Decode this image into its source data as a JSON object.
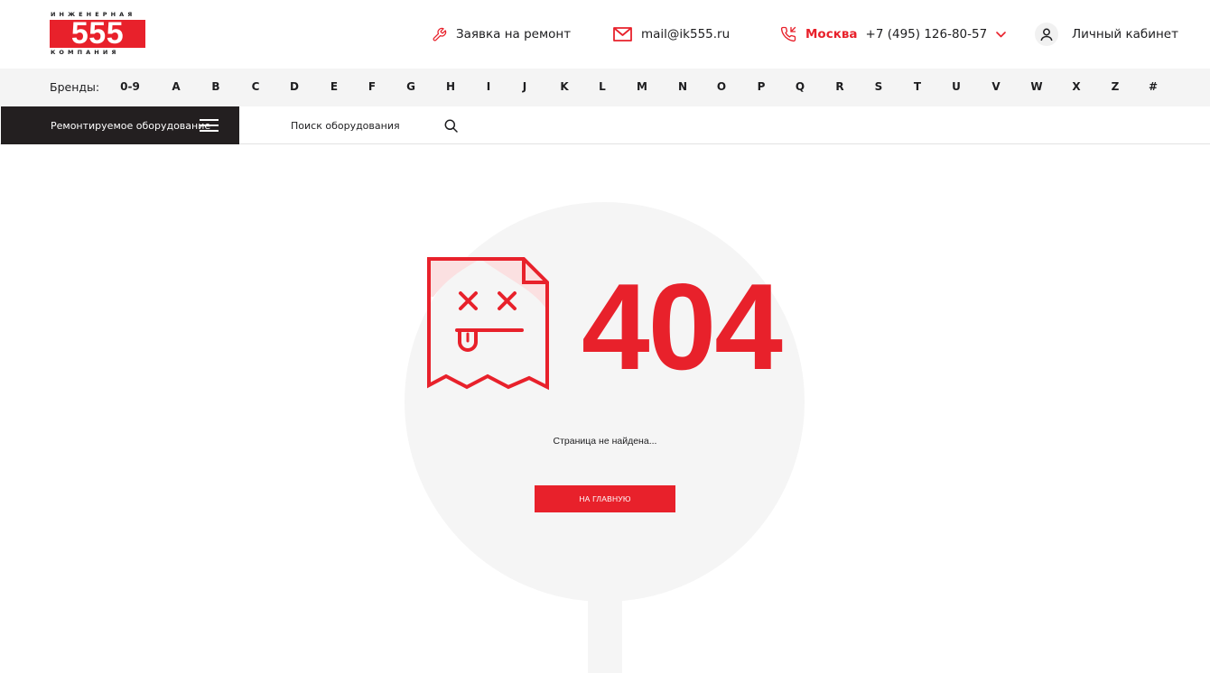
{
  "logo": {
    "top_caption": "ИНЖЕНЕРНАЯ",
    "number": "555",
    "bottom_caption": "КОМПАНИЯ"
  },
  "header": {
    "repair_request": "Заявка на ремонт",
    "repair_icon": "wrench-icon",
    "email": "mail@ik555.ru",
    "email_icon": "envelope-icon",
    "city": "Москва",
    "phone": "+7 (495) 126-80-57",
    "phone_icon": "phone-icon",
    "account": "Личный кабинет",
    "account_icon": "user-icon"
  },
  "brands": {
    "label": "Бренды:",
    "letters": [
      "0-9",
      "A",
      "B",
      "C",
      "D",
      "E",
      "F",
      "G",
      "H",
      "I",
      "J",
      "K",
      "L",
      "M",
      "N",
      "O",
      "P",
      "Q",
      "R",
      "S",
      "T",
      "U",
      "V",
      "W",
      "X",
      "Z",
      "#"
    ]
  },
  "nav": {
    "catalog_label": "Ремонтируемое оборудование",
    "search_placeholder": "Поиск оборудования"
  },
  "error": {
    "code": "404",
    "message": "Страница не найдена...",
    "home_button": "НА ГЛАВНУЮ"
  },
  "colors": {
    "accent": "#e8212b",
    "dark": "#231f20",
    "brand_bar_bg": "#f4f4f4",
    "disc_bg": "#f5f5f5"
  }
}
